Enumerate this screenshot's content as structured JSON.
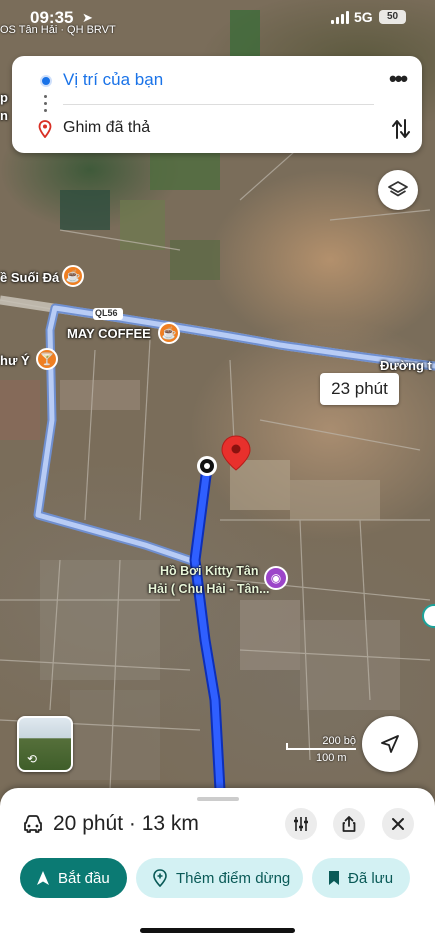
{
  "status_bar": {
    "time": "09:35",
    "network": "5G",
    "battery": "50",
    "cut_label": "OS Tân Hải · QH BRVT"
  },
  "route_card": {
    "origin": "Vị trí của bạn",
    "destination": "Ghim đã thả"
  },
  "map": {
    "road_badge": "QL56",
    "road_name": "Đường t",
    "route_time": "23 phút",
    "poi_1": "ề Suối Đá",
    "poi_2": "MAY COFFEE",
    "poi_3": "hư Ý",
    "poi_4_line1": "Hồ Bơi Kitty Tân",
    "poi_4_line2": "Hải ( Chu Hải - Tân...",
    "scale_top": "200 bộ",
    "scale_bottom": "100 m",
    "left_labels": [
      "p",
      "n"
    ]
  },
  "bottom_sheet": {
    "summary": "20 phút · 13 km",
    "start_label": "Bắt đầu",
    "add_stop_label": "Thêm điểm dừng",
    "saved_label": "Đã lưu"
  }
}
